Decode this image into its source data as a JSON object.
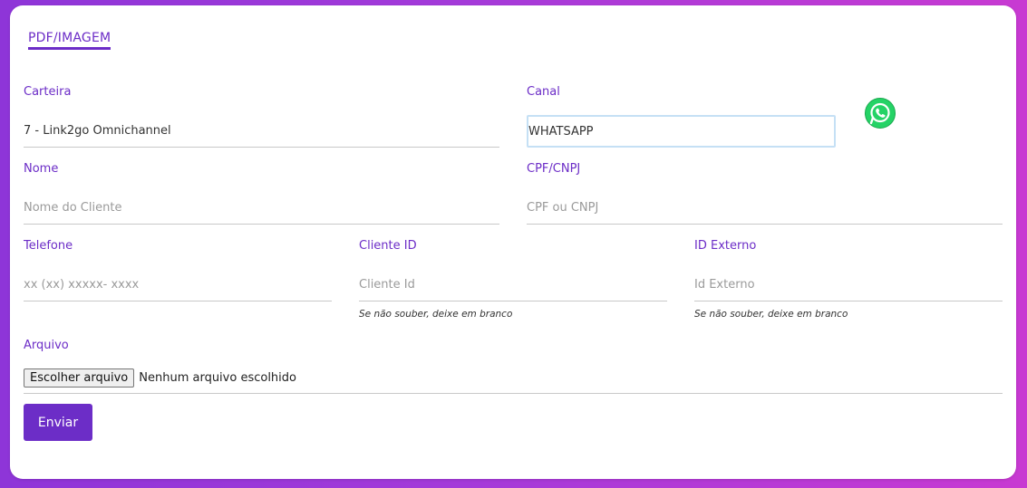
{
  "tab": {
    "label": "PDF/IMAGEM"
  },
  "carteira": {
    "label": "Carteira",
    "value": "7 - Link2go Omnichannel"
  },
  "canal": {
    "label": "Canal",
    "value": "WHATSAPP",
    "icon": "whatsapp-icon"
  },
  "nome": {
    "label": "Nome",
    "placeholder": "Nome do Cliente"
  },
  "cpf": {
    "label": "CPF/CNPJ",
    "placeholder": "CPF ou CNPJ"
  },
  "telefone": {
    "label": "Telefone",
    "placeholder": "xx (xx) xxxxx- xxxx"
  },
  "cliente_id": {
    "label": "Cliente ID",
    "placeholder": "Cliente Id",
    "hint": "Se não souber, deixe em branco"
  },
  "id_externo": {
    "label": "ID Externo",
    "placeholder": "Id Externo",
    "hint": "Se não souber, deixe em branco"
  },
  "arquivo": {
    "label": "Arquivo",
    "button_label": "Escolher arquivo",
    "status": "Nenhum arquivo escolhido"
  },
  "submit": {
    "label": "Enviar"
  },
  "colors": {
    "accent": "#6c2dc7",
    "whatsapp": "#25d366"
  }
}
